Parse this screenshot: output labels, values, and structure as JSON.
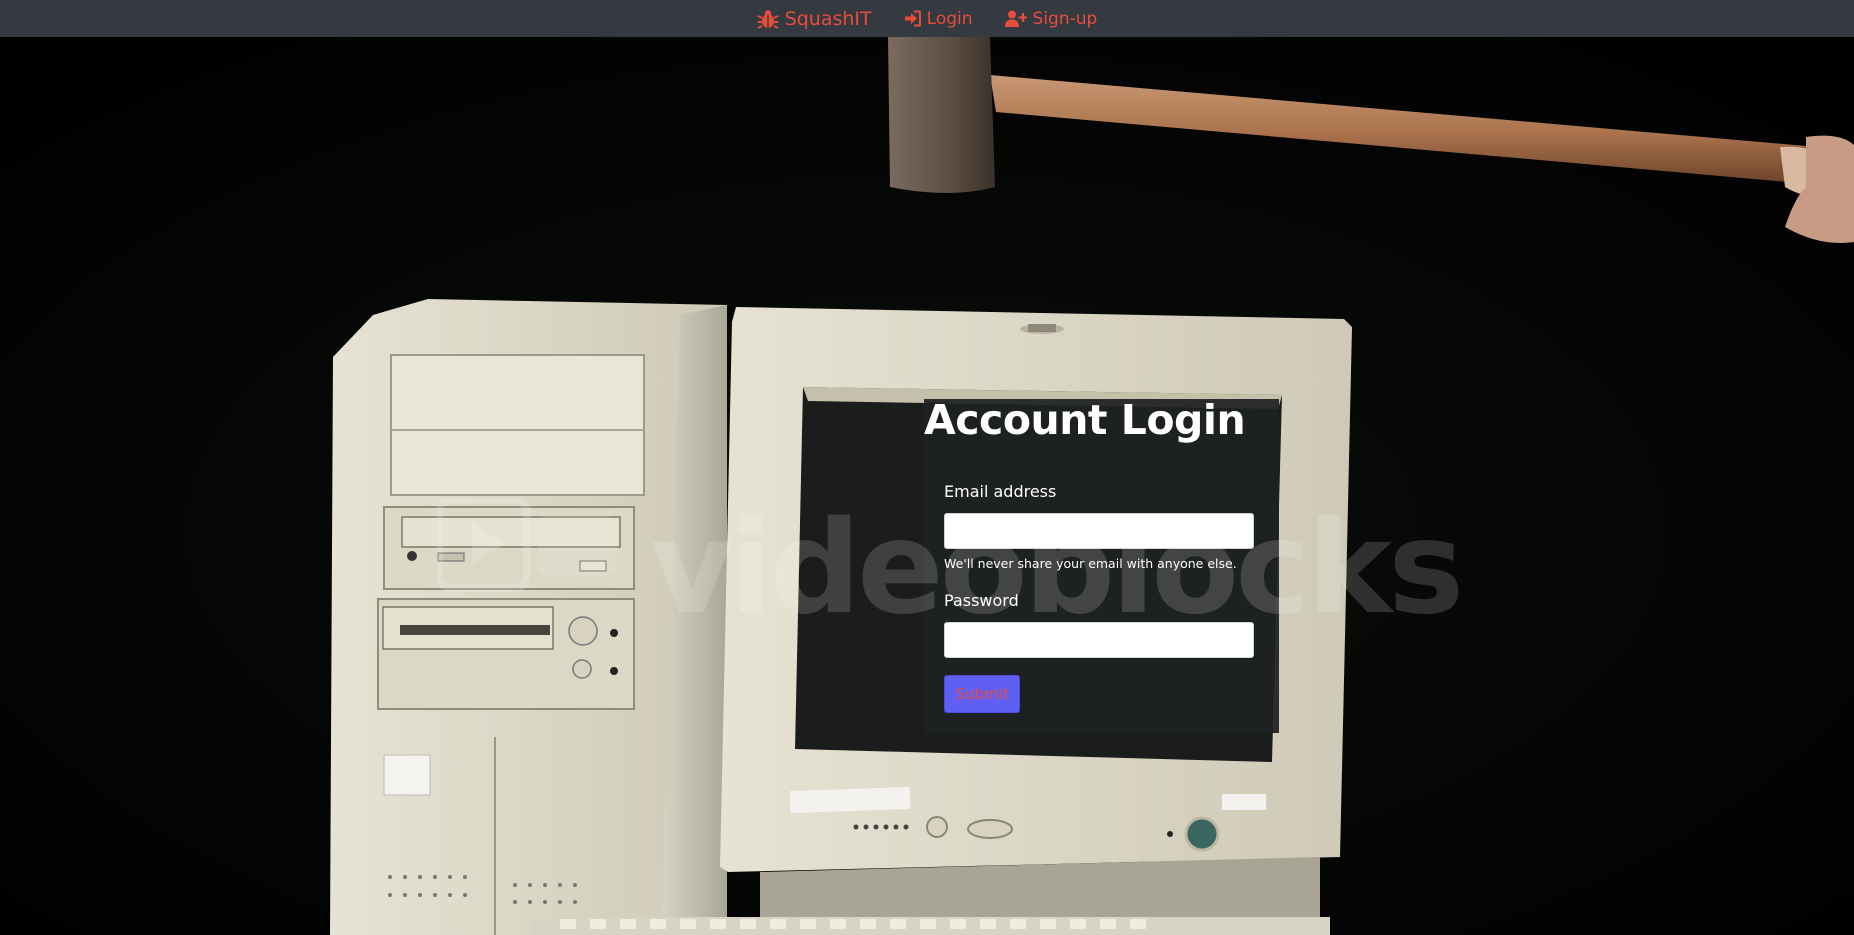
{
  "navbar": {
    "brand": "SquashIT",
    "login": "Login",
    "signup": "Sign-up"
  },
  "form": {
    "title": "Account Login",
    "email_label": "Email address",
    "email_value": "",
    "email_help": "We'll never share your email with anyone else.",
    "password_label": "Password",
    "password_value": "",
    "submit_label": "Submit"
  },
  "watermark": "videoblocks",
  "icons": {
    "brand": "bug-icon",
    "login": "sign-in-icon",
    "signup": "user-plus-icon"
  },
  "colors": {
    "navbar_bg": "#343a40",
    "nav_text": "#e74c3c",
    "submit_bg": "#5f5ff3"
  }
}
